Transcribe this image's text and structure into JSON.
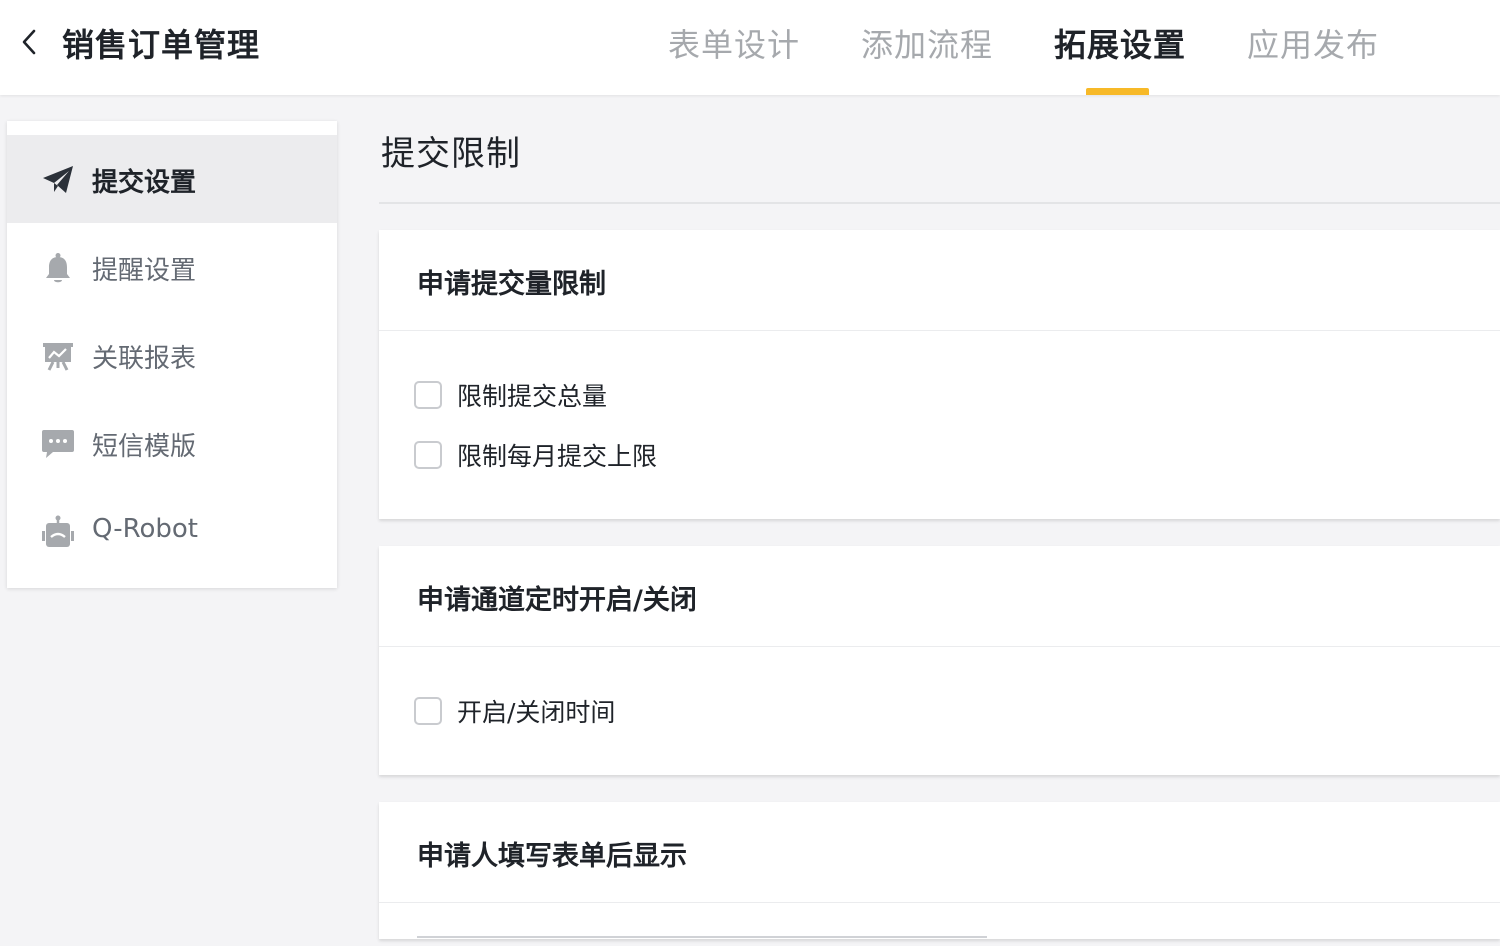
{
  "header": {
    "title": "销售订单管理",
    "tabs": [
      {
        "label": "表单设计",
        "active": false
      },
      {
        "label": "添加流程",
        "active": false
      },
      {
        "label": "拓展设置",
        "active": true
      },
      {
        "label": "应用发布",
        "active": false
      }
    ]
  },
  "sidebar": {
    "items": [
      {
        "label": "提交设置",
        "icon": "paper-plane-icon",
        "active": true
      },
      {
        "label": "提醒设置",
        "icon": "bell-icon",
        "active": false
      },
      {
        "label": "关联报表",
        "icon": "report-board-icon",
        "active": false
      },
      {
        "label": "短信模版",
        "icon": "chat-bubble-icon",
        "active": false
      },
      {
        "label": "Q-Robot",
        "icon": "robot-icon",
        "active": false
      }
    ]
  },
  "main": {
    "title": "提交限制",
    "sections": [
      {
        "title": "申请提交量限制",
        "options": [
          "限制提交总量",
          "限制每月提交上限"
        ]
      },
      {
        "title": "申请通道定时开启/关闭",
        "options": [
          "开启/关闭时间"
        ]
      },
      {
        "title": "申请人填写表单后显示",
        "options": []
      }
    ]
  },
  "colors": {
    "accent": "#f7b928",
    "background": "#f4f4f6",
    "active_item_bg": "#ececee"
  }
}
